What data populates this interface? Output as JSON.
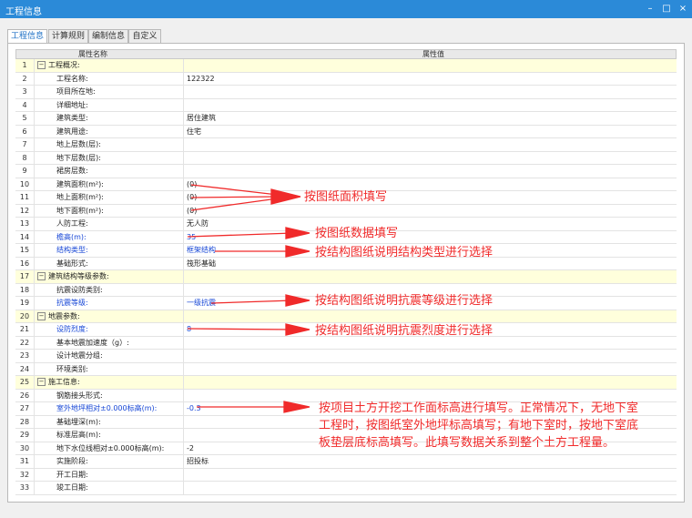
{
  "window": {
    "title": "工程信息",
    "minimize": "–",
    "maximize": "□",
    "close": "×"
  },
  "tabs": [
    "工程信息",
    "计算规则",
    "编制信息",
    "自定义"
  ],
  "table": {
    "columns": [
      "属性名称",
      "属性值"
    ],
    "rows": [
      {
        "num": "1",
        "name": "工程概况:",
        "value": "",
        "group": true
      },
      {
        "num": "2",
        "name": "工程名称:",
        "value": "122322"
      },
      {
        "num": "3",
        "name": "项目所在地:",
        "value": ""
      },
      {
        "num": "4",
        "name": "详细地址:",
        "value": ""
      },
      {
        "num": "5",
        "name": "建筑类型:",
        "value": "居住建筑"
      },
      {
        "num": "6",
        "name": "建筑用途:",
        "value": "住宅"
      },
      {
        "num": "7",
        "name": "地上层数(层):",
        "value": ""
      },
      {
        "num": "8",
        "name": "地下层数(层):",
        "value": ""
      },
      {
        "num": "9",
        "name": "裙房层数:",
        "value": ""
      },
      {
        "num": "10",
        "name": "建筑面积(m²):",
        "value": "(0)"
      },
      {
        "num": "11",
        "name": "地上面积(m²):",
        "value": "(0)"
      },
      {
        "num": "12",
        "name": "地下面积(m²):",
        "value": "(0)"
      },
      {
        "num": "13",
        "name": "人防工程:",
        "value": "无人防"
      },
      {
        "num": "14",
        "name": "檐高(m):",
        "value": "35",
        "blue": true
      },
      {
        "num": "15",
        "name": "结构类型:",
        "value": "框架结构",
        "blue": true
      },
      {
        "num": "16",
        "name": "基础形式:",
        "value": "筏形基础"
      },
      {
        "num": "17",
        "name": "建筑结构等级参数:",
        "value": "",
        "group": true
      },
      {
        "num": "18",
        "name": "抗震设防类别:",
        "value": ""
      },
      {
        "num": "19",
        "name": "抗震等级:",
        "value": "一级抗震",
        "blue": true
      },
      {
        "num": "20",
        "name": "地震参数:",
        "value": "",
        "group": true
      },
      {
        "num": "21",
        "name": "设防烈度:",
        "value": "8",
        "blue": true
      },
      {
        "num": "22",
        "name": "基本地震加速度（g）:",
        "value": ""
      },
      {
        "num": "23",
        "name": "设计地震分组:",
        "value": ""
      },
      {
        "num": "24",
        "name": "环境类别:",
        "value": ""
      },
      {
        "num": "25",
        "name": "施工信息:",
        "value": "",
        "group": true
      },
      {
        "num": "26",
        "name": "钢筋接头形式:",
        "value": ""
      },
      {
        "num": "27",
        "name": "室外地坪相对±0.000标高(m):",
        "value": "-0.3",
        "blue": true
      },
      {
        "num": "28",
        "name": "基础埋深(m):",
        "value": ""
      },
      {
        "num": "29",
        "name": "标准层高(m):",
        "value": ""
      },
      {
        "num": "30",
        "name": "地下水位线相对±0.000标高(m):",
        "value": "-2"
      },
      {
        "num": "31",
        "name": "实施阶段:",
        "value": "招投标"
      },
      {
        "num": "32",
        "name": "开工日期:",
        "value": ""
      },
      {
        "num": "33",
        "name": "竣工日期:",
        "value": ""
      }
    ]
  },
  "annotations": {
    "area": "按图纸面积填写",
    "height": "按图纸数据填写",
    "structure": "按结构图纸说明结构类型进行选择",
    "seismic_grade": "按结构图纸说明抗震等级进行选择",
    "intensity": "按结构图纸说明抗震烈度进行选择",
    "elevation_line1": "按项目土方开挖工作面标高进行填写。正常情况下，无地下室",
    "elevation_line2": "工程时，按图纸室外地坪标高填写；有地下室时，按地下室底",
    "elevation_line3": "板垫层底标高填写。此填写数据关系到整个土方工程量。"
  },
  "colors": {
    "titlebar": "#2b8ad8",
    "group_row": "#ffffdc",
    "annotation": "#f02a2a",
    "blue_text": "#1646d6"
  }
}
